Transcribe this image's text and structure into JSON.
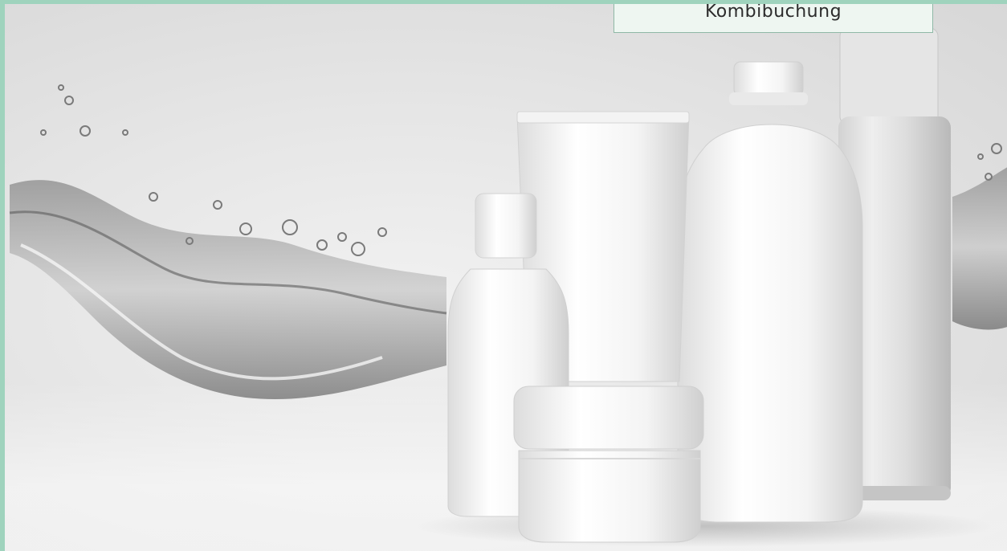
{
  "badge": {
    "label": "Kombibuchung"
  },
  "scene": {
    "subject": "cosmetic-bottles-with-water-splash",
    "palette": {
      "frame": "#9fd3bd",
      "badge_bg": "#eef6f1",
      "badge_border": "#8fb8a6",
      "background": "#e6e6e6"
    }
  }
}
